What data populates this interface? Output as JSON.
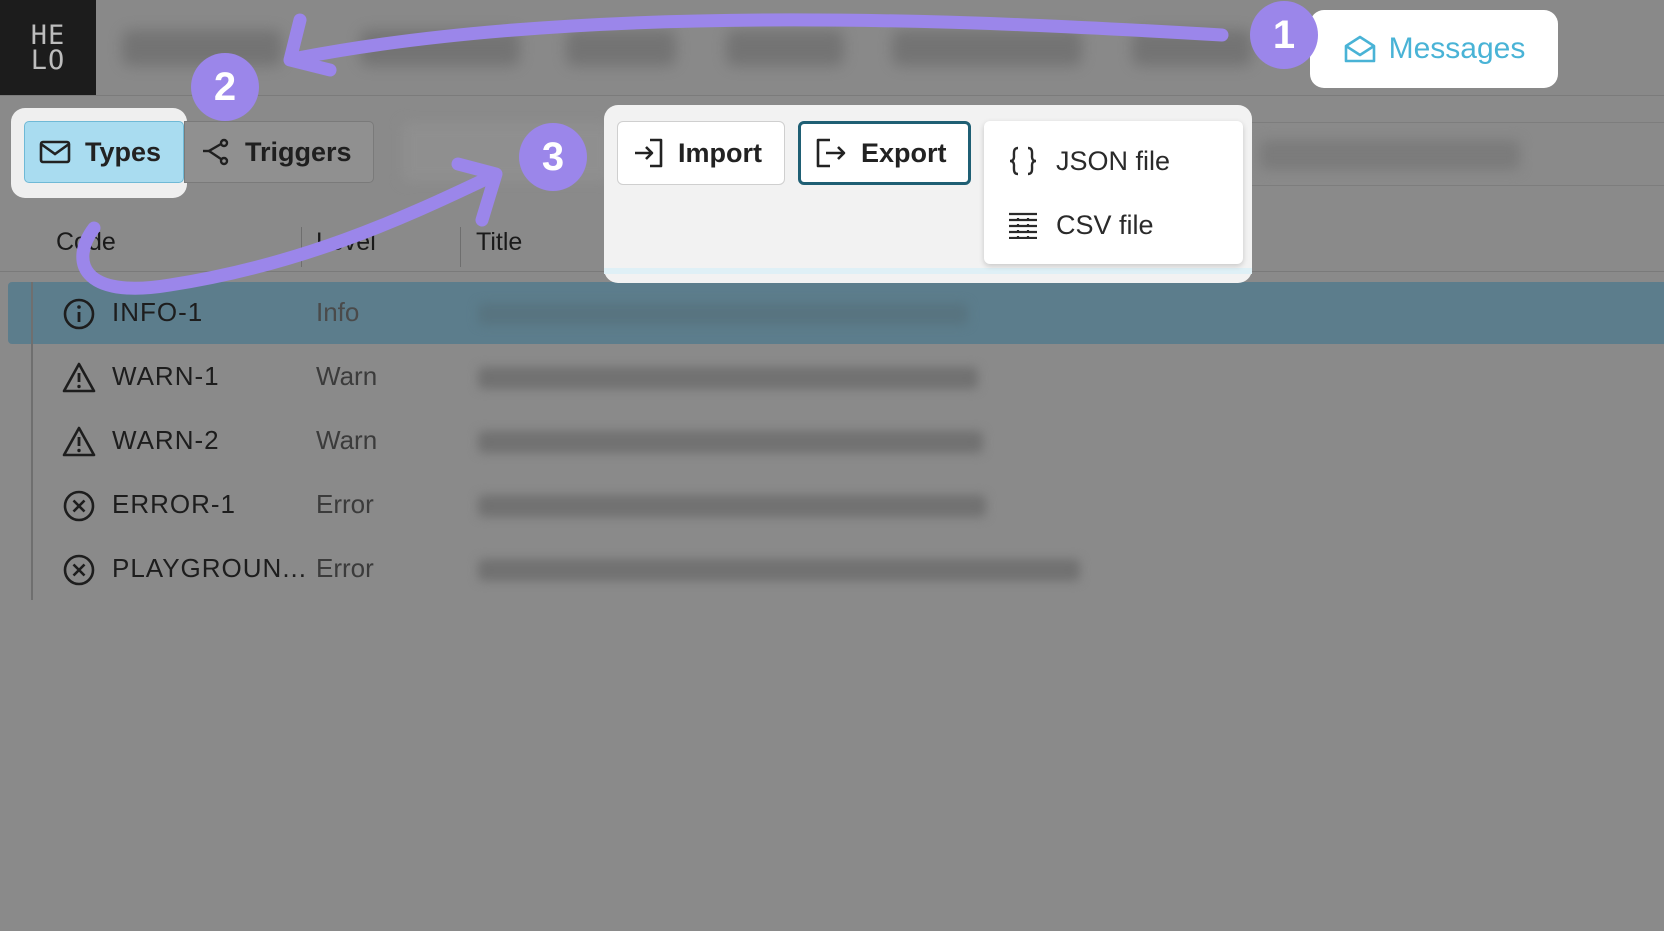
{
  "app": {
    "logo_top": "HE",
    "logo_bottom": "LO"
  },
  "header": {
    "messages_label": "Messages"
  },
  "toolbar": {
    "types_label": "Types",
    "triggers_label": "Triggers",
    "import_label": "Import",
    "export_label": "Export"
  },
  "export_menu": {
    "items": [
      {
        "label": "JSON file",
        "icon": "braces-icon"
      },
      {
        "label": "CSV file",
        "icon": "table-icon"
      }
    ]
  },
  "table": {
    "columns": [
      "Code",
      "Level",
      "Title"
    ],
    "rows": [
      {
        "code": "INFO-1",
        "level": "Info",
        "icon": "info-icon",
        "selected": true
      },
      {
        "code": "WARN-1",
        "level": "Warn",
        "icon": "warning-icon"
      },
      {
        "code": "WARN-2",
        "level": "Warn",
        "icon": "warning-icon"
      },
      {
        "code": "ERROR-1",
        "level": "Error",
        "icon": "error-icon"
      },
      {
        "code": "PLAYGROUN...",
        "level": "Error",
        "icon": "error-icon"
      }
    ]
  },
  "annotations": {
    "steps": [
      "1",
      "2",
      "3"
    ],
    "color": "#9b86ea"
  },
  "colors": {
    "accent": "#49b3d6",
    "selected_row": "#5c7d8c",
    "types_active": "#a9dcf0",
    "export_border": "#1f5f74"
  }
}
